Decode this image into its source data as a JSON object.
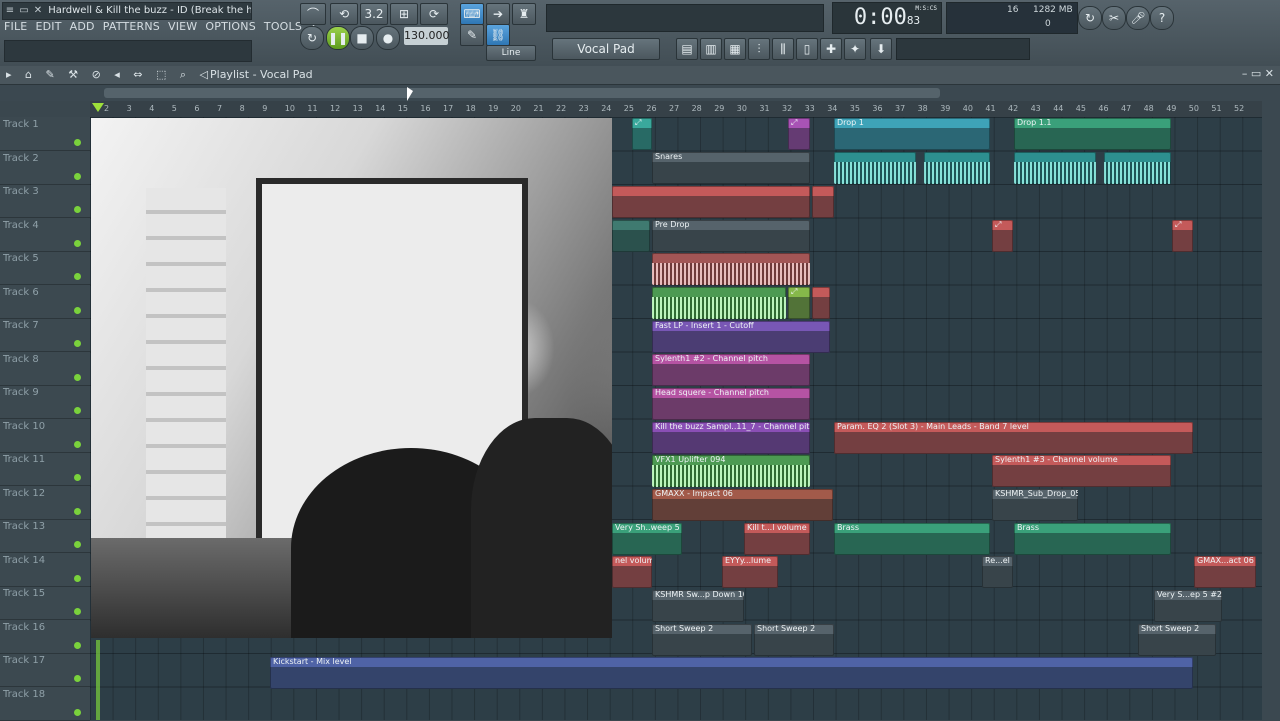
{
  "window": {
    "title": "Hardwell & Kill the buzz - ID (Break the hou..."
  },
  "menu": [
    "FILE",
    "EDIT",
    "ADD",
    "PATTERNS",
    "VIEW",
    "OPTIONS",
    "TOOLS",
    "?"
  ],
  "transport": {
    "tempo": "130.000",
    "snap": "Line",
    "pattern": "Vocal Pad",
    "time": "0:00",
    "time_small": "83",
    "time_units": "M:S:CS",
    "cpu": "16",
    "memory": "1282 MB",
    "polyphony": "0",
    "step_value": "3.2"
  },
  "playlist": {
    "title": "Playlist - Vocal Pad"
  },
  "ruler": [
    "2",
    "3",
    "4",
    "5",
    "6",
    "7",
    "8",
    "9",
    "10",
    "11",
    "12",
    "13",
    "14",
    "15",
    "16",
    "17",
    "18",
    "19",
    "20",
    "21",
    "22",
    "23",
    "24",
    "25",
    "26",
    "27",
    "28",
    "29",
    "30",
    "31",
    "32",
    "33",
    "34",
    "35",
    "36",
    "37",
    "38",
    "39",
    "40",
    "41",
    "42",
    "43",
    "44",
    "45",
    "46",
    "47",
    "48",
    "49",
    "50",
    "51",
    "52"
  ],
  "tracks": [
    "Track 1",
    "Track 2",
    "Track 3",
    "Track 4",
    "Track 5",
    "Track 6",
    "Track 7",
    "Track 8",
    "Track 9",
    "Track 10",
    "Track 11",
    "Track 12",
    "Track 13",
    "Track 14",
    "Track 15",
    "Track 16",
    "Track 17",
    "Track 18"
  ],
  "clips": {
    "drop1": "Drop 1",
    "drop11": "Drop 1.1",
    "snares": "Snares",
    "predrop": "Pre Drop",
    "fastlp": "Fast LP - Insert 1 - Cutoff",
    "syn2": "Sylenth1 #2 - Channel pitch",
    "headsq": "Head squere - Channel pitch",
    "killbuzz": "Kill the buzz Sampl..11_7 - Channel pitch",
    "parameq": "Param. EQ 2 (Slot 3) - Main Leads - Band 7 level",
    "vfx": "VFX1 Uplifter 094",
    "syn3": "Sylenth1 #3 - Channel volume",
    "gmaxx": "GMAXX - Impact 06",
    "kshmrsub": "KSHMR_Sub_Drop_05",
    "verysh": "Very Sh..weep 5",
    "killt": "Kill t...l volume",
    "brass1": "Brass",
    "brass2": "Brass",
    "nelvol": "nel volume",
    "eyyy": "EYYy...lume",
    "rem": "Re...el",
    "gmaxact": "GMAX...act 06",
    "kshmrsw": "KSHMR Sw...p Down 10",
    "veryep": "Very S...ep 5 #2",
    "short1": "Short Sweep 2",
    "short2": "Short Sweep 2",
    "short3": "Short Sweep 2",
    "kickstart": "Kickstart - Mix level"
  }
}
